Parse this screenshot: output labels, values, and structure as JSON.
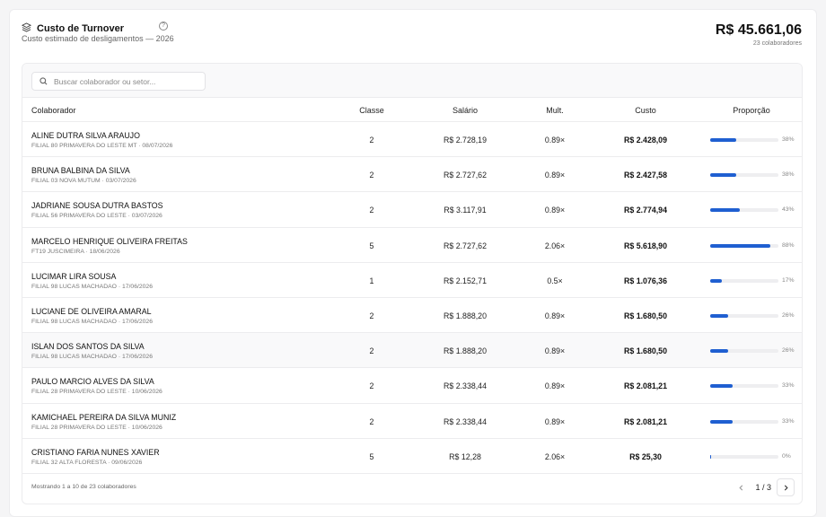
{
  "header": {
    "title": "Custo de Turnover",
    "subtitle": "Custo estimado de desligamentos — 2026",
    "help_symbol": "?",
    "total": "R$ 45.661,06",
    "total_sub": "23 colaboradores"
  },
  "search": {
    "placeholder": "Buscar colaborador ou setor...",
    "value": ""
  },
  "columns": {
    "colaborador": "Colaborador",
    "classe": "Classe",
    "salario": "Salário",
    "mult": "Mult.",
    "custo": "Custo",
    "proporcao": "Proporção"
  },
  "rows": [
    {
      "name": "ALINE DUTRA SILVA ARAUJO",
      "meta": "FILIAL 80 PRIMAVERA DO LESTE MT · 08/07/2026",
      "classe": "2",
      "salario": "R$ 2.728,19",
      "mult": "0.89×",
      "custo": "R$ 2.428,09",
      "pct": "38%",
      "share": 0.38
    },
    {
      "name": "BRUNA BALBINA DA SILVA",
      "meta": "FILIAL 03 NOVA MUTUM · 03/07/2026",
      "classe": "2",
      "salario": "R$ 2.727,62",
      "mult": "0.89×",
      "custo": "R$ 2.427,58",
      "pct": "38%",
      "share": 0.38
    },
    {
      "name": "JADRIANE SOUSA DUTRA BASTOS",
      "meta": "FILIAL 56 PRIMAVERA DO LESTE · 03/07/2026",
      "classe": "2",
      "salario": "R$ 3.117,91",
      "mult": "0.89×",
      "custo": "R$ 2.774,94",
      "pct": "43%",
      "share": 0.43
    },
    {
      "name": "MARCELO HENRIQUE OLIVEIRA FREITAS",
      "meta": "FT19 JUSCIMEIRA · 18/06/2026",
      "classe": "5",
      "salario": "R$ 2.727,62",
      "mult": "2.06×",
      "custo": "R$ 5.618,90",
      "pct": "88%",
      "share": 0.88
    },
    {
      "name": "LUCIMAR LIRA SOUSA",
      "meta": "FILIAL 98 LUCAS MACHADAO · 17/06/2026",
      "classe": "1",
      "salario": "R$ 2.152,71",
      "mult": "0.5×",
      "custo": "R$ 1.076,36",
      "pct": "17%",
      "share": 0.17
    },
    {
      "name": "LUCIANE DE OLIVEIRA AMARAL",
      "meta": "FILIAL 98 LUCAS MACHADAO · 17/06/2026",
      "classe": "2",
      "salario": "R$ 1.888,20",
      "mult": "0.89×",
      "custo": "R$ 1.680,50",
      "pct": "26%",
      "share": 0.26
    },
    {
      "name": "ISLAN DOS SANTOS DA SILVA",
      "meta": "FILIAL 98 LUCAS MACHADAO · 17/06/2026",
      "classe": "2",
      "salario": "R$ 1.888,20",
      "mult": "0.89×",
      "custo": "R$ 1.680,50",
      "pct": "26%",
      "share": 0.26
    },
    {
      "name": "PAULO MARCIO ALVES DA SILVA",
      "meta": "FILIAL 28 PRIMAVERA DO LESTE · 10/06/2026",
      "classe": "2",
      "salario": "R$ 2.338,44",
      "mult": "0.89×",
      "custo": "R$ 2.081,21",
      "pct": "33%",
      "share": 0.33
    },
    {
      "name": "KAMICHAEL PEREIRA DA SILVA MUNIZ",
      "meta": "FILIAL 28 PRIMAVERA DO LESTE · 10/06/2026",
      "classe": "2",
      "salario": "R$ 2.338,44",
      "mult": "0.89×",
      "custo": "R$ 2.081,21",
      "pct": "33%",
      "share": 0.33
    },
    {
      "name": "CRISTIANO FARIA NUNES XAVIER",
      "meta": "FILIAL 32 ALTA FLORESTA · 09/06/2026",
      "classe": "5",
      "salario": "R$ 12,28",
      "mult": "2.06×",
      "custo": "R$ 25,30",
      "pct": "0%",
      "share": 0.0
    }
  ],
  "highlighted_row": 6,
  "footer": {
    "summary": "Mostrando 1 a 10 de 23 colaboradores",
    "page_info": "1 / 3"
  },
  "colors": {
    "bar_fill": "#1f5fd1",
    "bar_track": "#eeeef0"
  },
  "icons": {
    "title": "layers-icon",
    "search": "search-icon",
    "prev": "chevron-left-icon",
    "next": "chevron-right-icon"
  }
}
